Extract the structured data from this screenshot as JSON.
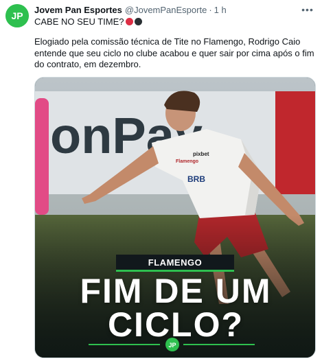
{
  "tweet": {
    "author_name": "Jovem Pan Esportes",
    "handle": "@JovemPanEsporte",
    "separator": "·",
    "time": "1 h",
    "headline": "CABE NO SEU TIME?",
    "headline_emojis": [
      "red-circle",
      "black-circle"
    ],
    "body": "Elogiado pela comissão técnica de Tite no Flamengo, Rodrigo Caio entende que seu ciclo no clube acabou e quer sair por cima após o fim do contrato, em dezembro."
  },
  "image": {
    "banner_text": "onPay",
    "shirt_sponsors": [
      "pixbet",
      "BRB",
      "Flamengo"
    ],
    "tag": "FLAMENGO",
    "title_line1": "FIM DE UM",
    "title_line2": "CICLO?"
  },
  "colors": {
    "brand_green": "#2ec04f",
    "text": "#0f1419",
    "muted": "#536471",
    "flamengo_red": "#b0272b"
  }
}
